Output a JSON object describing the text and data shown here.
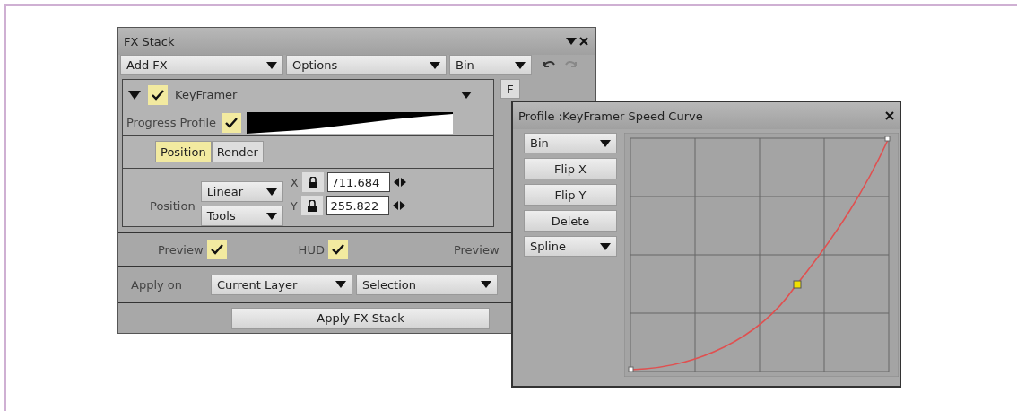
{
  "fx_stack": {
    "title": "FX Stack",
    "toolbar": [
      {
        "label": "Add FX",
        "kind": "dropdown"
      },
      {
        "label": "Options",
        "kind": "dropdown"
      },
      {
        "label": "Bin",
        "kind": "dropdown"
      }
    ],
    "effect": {
      "name": "KeyFramer",
      "expanded": true,
      "enabled": true,
      "side_button": "F",
      "progress_profile": {
        "label": "Progress Profile",
        "checked": true
      },
      "tabs": [
        {
          "label": "Position",
          "selected": true
        },
        {
          "label": "Render",
          "selected": false
        }
      ],
      "position": {
        "label": "Position",
        "dropdowns": [
          "Linear",
          "Tools"
        ],
        "fields": [
          {
            "axis": "X",
            "value": "711.684",
            "locked": true
          },
          {
            "axis": "Y",
            "value": "255.822",
            "locked": true
          }
        ]
      }
    },
    "preview_row": [
      {
        "label": "Preview",
        "checked": true
      },
      {
        "label": "HUD",
        "checked": true
      }
    ],
    "preview_right": "Preview",
    "apply_on": {
      "label": "Apply on",
      "dropdowns": [
        "Current Layer",
        "Selection"
      ]
    },
    "apply_button": "Apply FX Stack"
  },
  "profile_dialog": {
    "title": "Profile :KeyFramer Speed Curve",
    "controls": [
      {
        "label": "Bin",
        "kind": "dropdown"
      },
      {
        "label": "Flip X",
        "kind": "button"
      },
      {
        "label": "Flip Y",
        "kind": "button"
      },
      {
        "label": "Delete",
        "kind": "button"
      },
      {
        "label": "Spline",
        "kind": "dropdown"
      }
    ]
  }
}
